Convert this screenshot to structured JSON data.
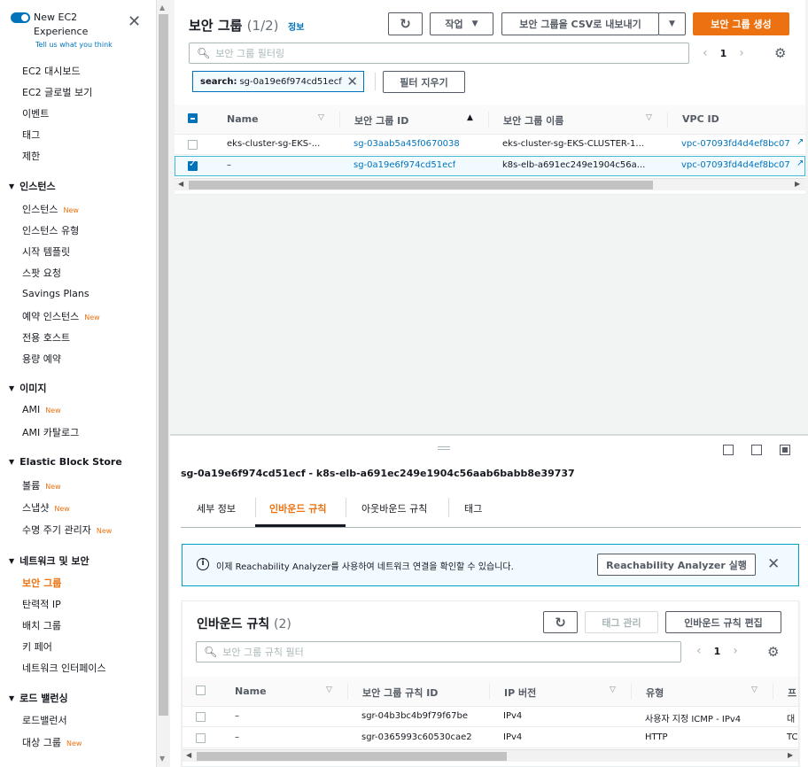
{
  "sidebar": {
    "toggle_title": "New EC2 Experience",
    "toggle_sub": "Tell us what you think",
    "items": {
      "dashboard": "EC2 대시보드",
      "global_view": "EC2 글로벌 보기",
      "events": "이벤트",
      "tags": "태그",
      "limits": "제한"
    },
    "instances_section": "인스턴스",
    "instances": [
      "인스턴스",
      "인스턴스 유형",
      "시작 템플릿",
      "스팟 요청",
      "Savings Plans",
      "예약 인스턴스",
      "전용 호스트",
      "용량 예약"
    ],
    "images_section": "이미지",
    "images": [
      "AMI",
      "AMI 카탈로그"
    ],
    "ebs_section": "Elastic Block Store",
    "ebs": [
      "볼륨",
      "스냅샷",
      "수명 주기 관리자"
    ],
    "network_section": "네트워크 및 보안",
    "network": [
      "보안 그룹",
      "탄력적 IP",
      "배치 그룹",
      "키 페어",
      "네트워크 인터페이스"
    ],
    "lb_section": "로드 밸런싱",
    "lb": [
      "로드밸런서",
      "대상 그룹"
    ],
    "new_badge": "New"
  },
  "top": {
    "title": "보안 그룹",
    "count": "(1/2)",
    "info": "정보",
    "actions_label": "작업",
    "export_label": "보안 그룹을 CSV로 내보내기",
    "create_label": "보안 그룹 생성",
    "filter_placeholder": "보안 그룹 필터링",
    "page": "1",
    "token_key": "search:",
    "token_value": "sg-0a19e6f974cd51ecf",
    "clear_filters": "필터 지우기",
    "columns": [
      "Name",
      "보안 그룹 ID",
      "보안 그룹 이름",
      "VPC ID"
    ],
    "rows": [
      {
        "name": "eks-cluster-sg-EKS-...",
        "id": "sg-03aab5a45f0670038",
        "group_name": "eks-cluster-sg-EKS-CLUSTER-1...",
        "vpc": "vpc-07093fd4d4ef8bc07"
      },
      {
        "name": "–",
        "id": "sg-0a19e6f974cd51ecf",
        "group_name": "k8s-elb-a691ec249e1904c56a...",
        "vpc": "vpc-07093fd4d4ef8bc07"
      }
    ]
  },
  "detail": {
    "title": "sg-0a19e6f974cd51ecf - k8s-elb-a691ec249e1904c56aab6babb8e39737",
    "tabs": [
      "세부 정보",
      "인바운드 규칙",
      "아웃바운드 규칙",
      "태그"
    ],
    "alert_text": "이제 Reachability Analyzer를 사용하여 네트워크 연결을 확인할 수 있습니다.",
    "alert_button": "Reachability Analyzer 실행",
    "inbound_title": "인바운드 규칙",
    "inbound_count": "(2)",
    "manage_tags": "태그 관리",
    "edit_inbound": "인바운드 규칙 편집",
    "rules_filter_placeholder": "보안 그룹 규칙 필터",
    "page": "1",
    "columns": [
      "Name",
      "보안 그룹 규칙 ID",
      "IP 버전",
      "유형",
      "프"
    ],
    "rules": [
      {
        "name": "–",
        "id": "sgr-04b3bc4b9f79f67be",
        "ip": "IPv4",
        "type": "사용자 지정 ICMP - IPv4",
        "proto": "대"
      },
      {
        "name": "–",
        "id": "sgr-0365993c60530cae2",
        "ip": "IPv4",
        "type": "HTTP",
        "proto": "TC"
      }
    ]
  },
  "colors": {
    "accent": "#ec7211",
    "link": "#0073bb",
    "selected_bg": "#f1faff"
  }
}
